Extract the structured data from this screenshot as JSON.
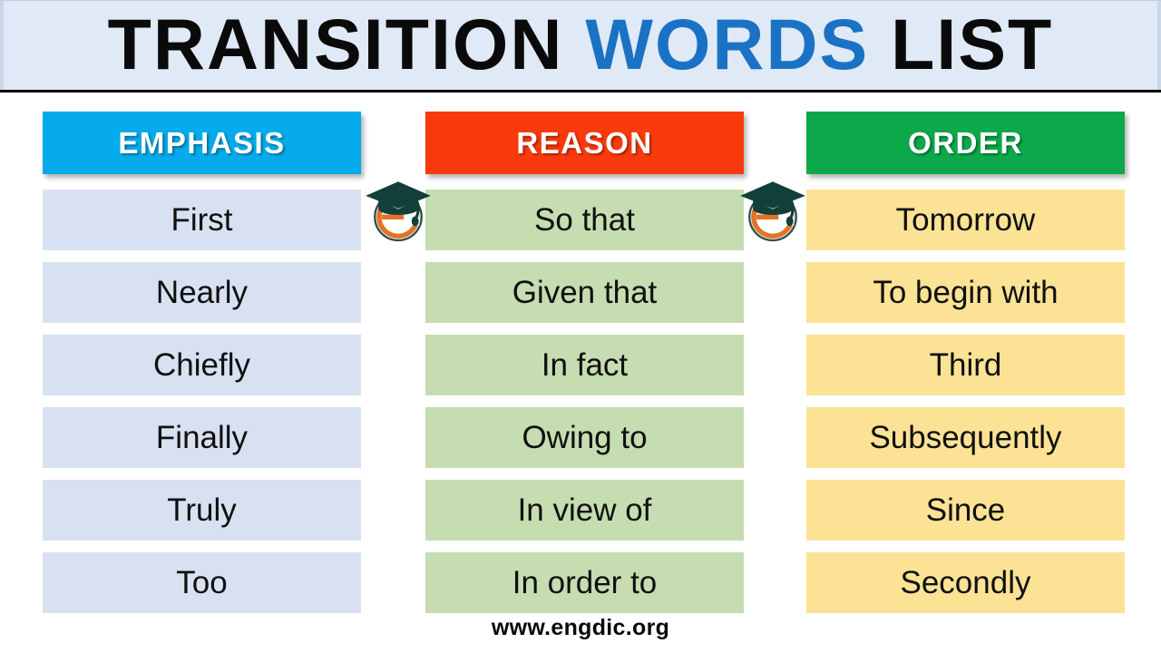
{
  "title": {
    "part1": "TRANSITION",
    "part2": "WORDS",
    "part3": "LIST",
    "part1_color": "#0a0a0a",
    "part2_color": "#1a72c4",
    "part3_color": "#0a0a0a",
    "bar_background": "#e0e9f6"
  },
  "columns": [
    {
      "header": "EMPHASIS",
      "header_color": "#05ABEB",
      "cell_color": "#d8e1f1",
      "words": [
        "First",
        "Nearly",
        "Chiefly",
        "Finally",
        "Truly",
        "Too"
      ]
    },
    {
      "header": "REASON",
      "header_color": "#F93A0C",
      "cell_color": "#c5ddb1",
      "words": [
        "So that",
        "Given that",
        "In fact",
        "Owing to",
        "In view of",
        "In order to"
      ]
    },
    {
      "header": "ORDER",
      "header_color": "#0CA94A",
      "cell_color": "#FBE295",
      "words": [
        "Tomorrow",
        "To begin with",
        "Third",
        "Subsequently",
        "Since",
        "Secondly"
      ]
    }
  ],
  "logos": [
    {
      "name": "engdic-logo",
      "letter": "e",
      "cap_color": "#123f3a",
      "letter_color": "#E2742A"
    },
    {
      "name": "engdic-logo",
      "letter": "e",
      "cap_color": "#123f3a",
      "letter_color": "#E2742A"
    }
  ],
  "footer": {
    "website": "www.engdic.org"
  }
}
